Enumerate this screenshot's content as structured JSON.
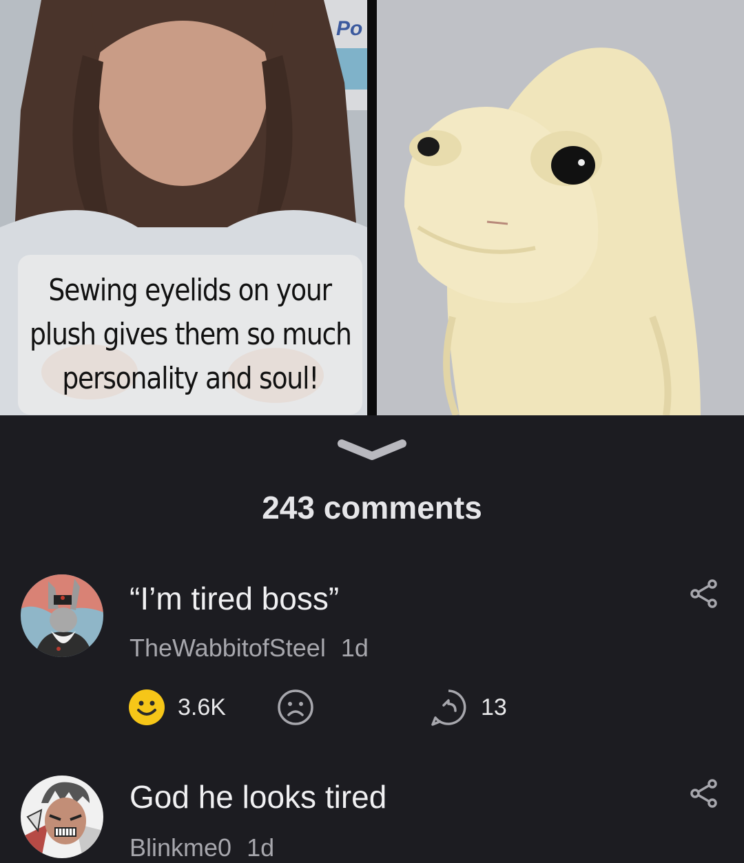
{
  "post": {
    "caption_lines": [
      "Sewing eyelids on your",
      "plush gives them so much",
      "personality and soul!"
    ],
    "watermark": "Po"
  },
  "comments_header": "243 comments",
  "comments": [
    {
      "text": "“I’m tired boss”",
      "user": "TheWabbitofSteel",
      "age": "1d",
      "upvotes": "3.6K",
      "replies": "13"
    },
    {
      "text": "God he looks tired",
      "user": "Blinkme0",
      "age": "1d"
    }
  ],
  "colors": {
    "accent_upvote": "#f6c618",
    "background": "#1c1c21",
    "muted": "#a7a7ad"
  }
}
